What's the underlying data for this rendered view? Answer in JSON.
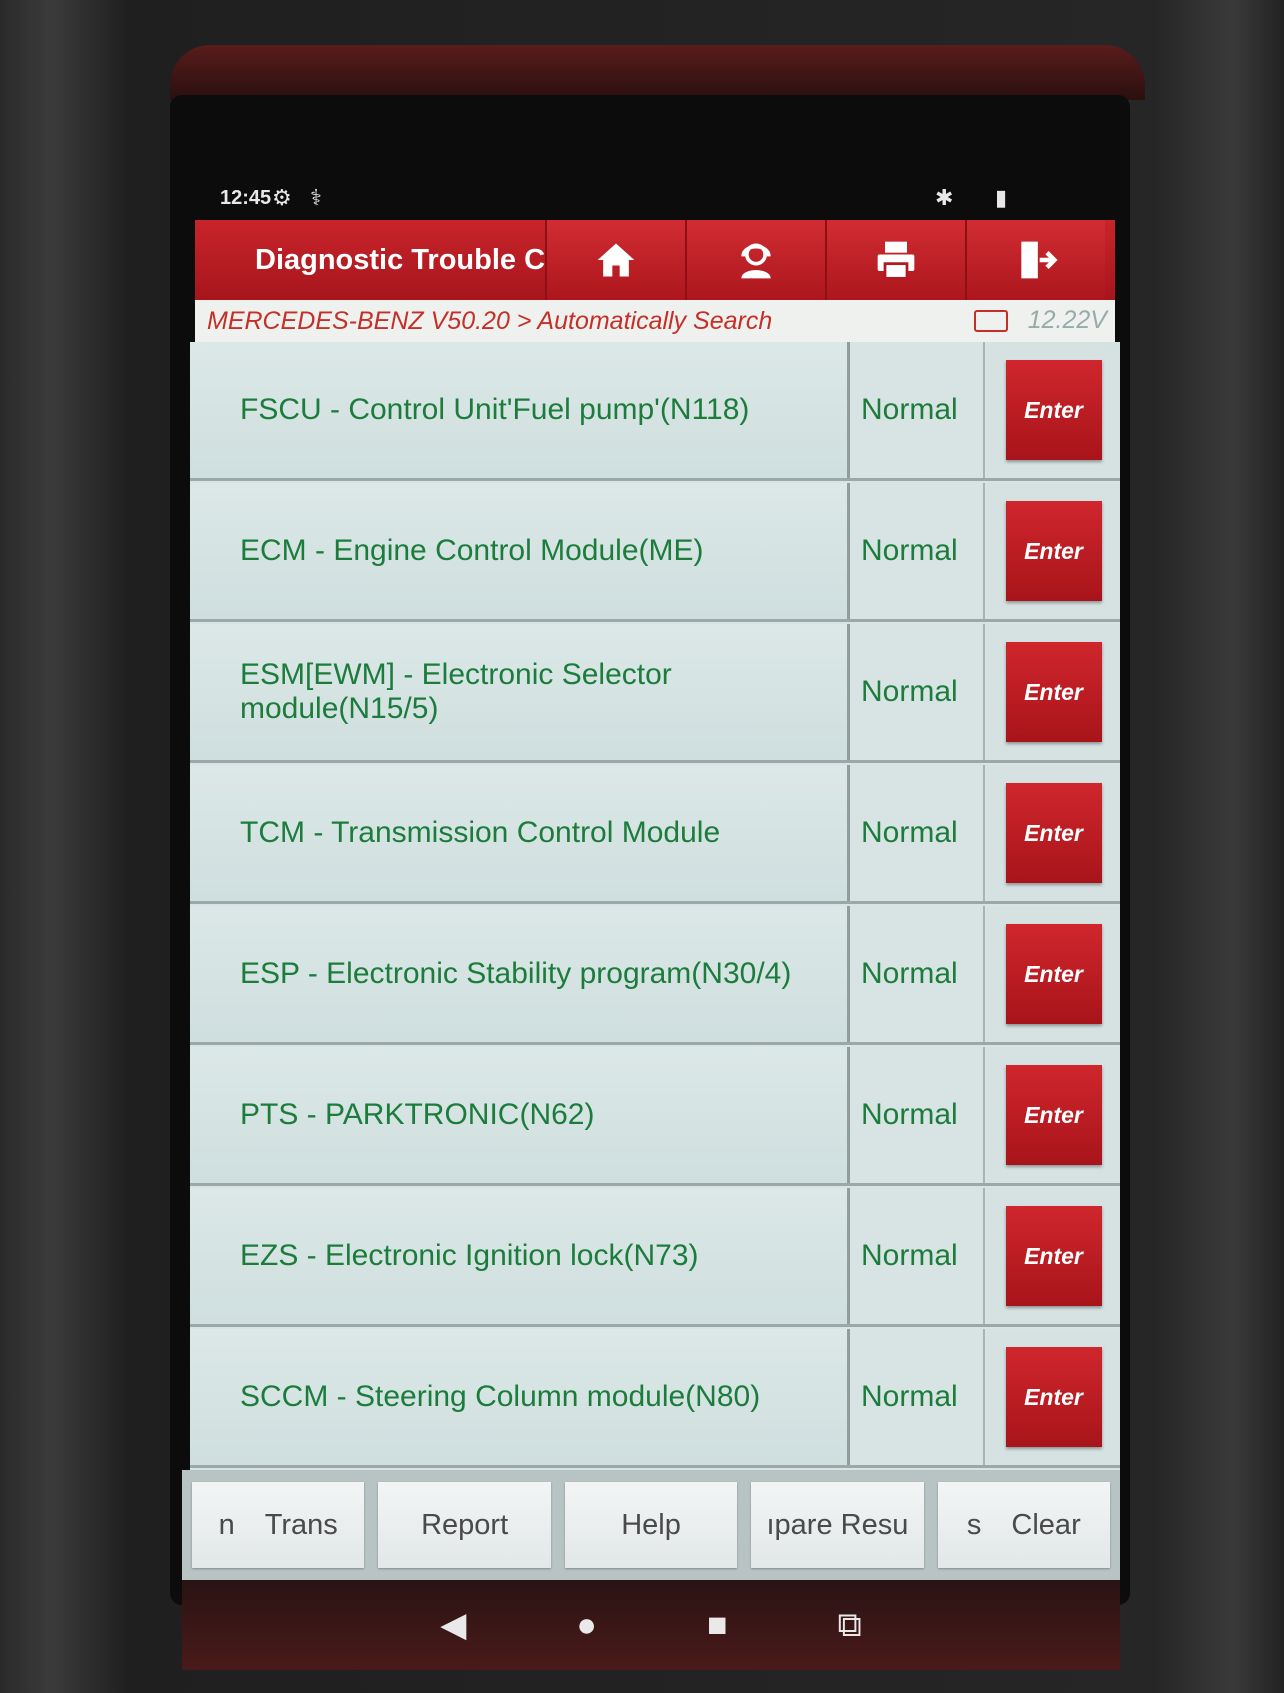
{
  "statusbar": {
    "time": "12:45"
  },
  "appbar": {
    "title": "Diagnostic Trouble C",
    "nav_icons": [
      "home-icon",
      "support-agent-icon",
      "print-icon",
      "exit-icon"
    ]
  },
  "breadcrumb": {
    "path": "MERCEDES-BENZ V50.20 > Automatically Search",
    "voltage": "12.22V"
  },
  "modules": [
    {
      "name": "FSCU - Control Unit'Fuel pump'(N118)",
      "status": "Normal",
      "action": "Enter"
    },
    {
      "name": "ECM - Engine Control Module(ME)",
      "status": "Normal",
      "action": "Enter"
    },
    {
      "name": "ESM[EWM] - Electronic Selector module(N15/5)",
      "status": "Normal",
      "action": "Enter"
    },
    {
      "name": "TCM - Transmission Control Module",
      "status": "Normal",
      "action": "Enter"
    },
    {
      "name": "ESP - Electronic Stability program(N30/4)",
      "status": "Normal",
      "action": "Enter"
    },
    {
      "name": "PTS - PARKTRONIC(N62)",
      "status": "Normal",
      "action": "Enter"
    },
    {
      "name": "EZS - Electronic Ignition lock(N73)",
      "status": "Normal",
      "action": "Enter"
    },
    {
      "name": "SCCM - Steering Column module(N80)",
      "status": "Normal",
      "action": "Enter"
    }
  ],
  "toolbar": {
    "b1_a": "n",
    "b1_b": "Trans",
    "b2": "Report",
    "b3": "Help",
    "b4": "ıpare Resu",
    "b5_a": "s",
    "b5_b": "Clear"
  },
  "colors": {
    "accent_red": "#c8242b",
    "status_green": "#1c7c3c",
    "breadcrumb_red": "#c43028"
  }
}
